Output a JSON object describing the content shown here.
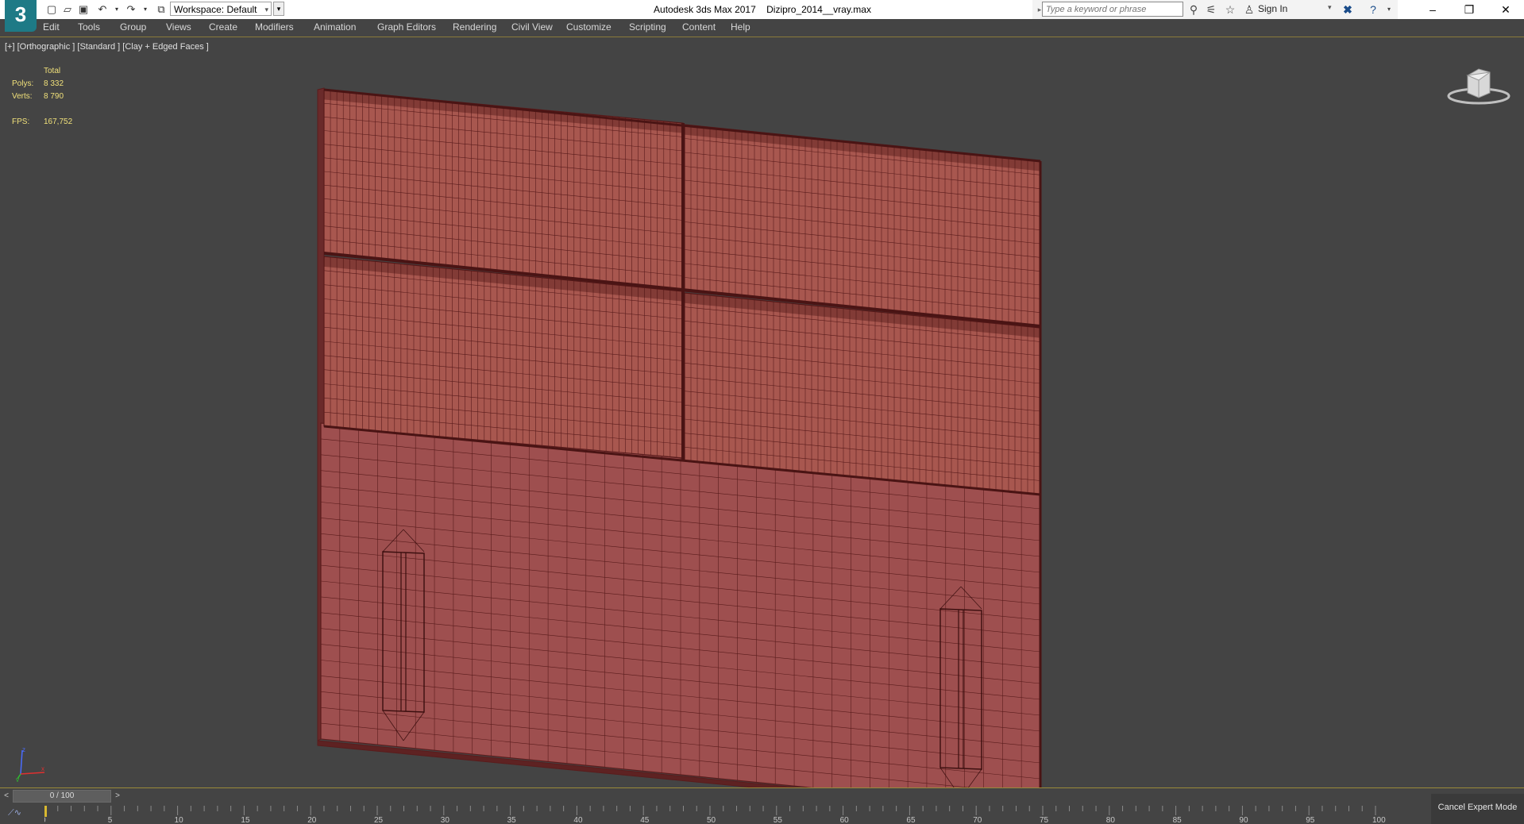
{
  "app": {
    "logo_text": "3",
    "window_title": "Autodesk 3ds Max 2017    Dizipro_2014__vray.max"
  },
  "quick_access": {
    "workspace_value": "Workspace: Default",
    "icons": [
      "new-file-icon",
      "open-file-icon",
      "save-icon",
      "undo-icon",
      "redo-icon",
      "project-folder-icon"
    ]
  },
  "search": {
    "placeholder": "Type a keyword or phrase"
  },
  "account": {
    "sign_in_label": "Sign In"
  },
  "window_controls": {
    "minimize": "–",
    "restore": "❐",
    "close": "✕"
  },
  "menu": {
    "items": [
      "Edit",
      "Tools",
      "Group",
      "Views",
      "Create",
      "Modifiers",
      "Animation",
      "Graph Editors",
      "Rendering",
      "Civil View",
      "Customize",
      "Scripting",
      "Content",
      "Help"
    ]
  },
  "viewport": {
    "label": "[+] [Orthographic ] [Standard ] [Clay + Edged Faces ]",
    "stats": {
      "header": "Total",
      "polys_label": "Polys:",
      "polys_value": "8 332",
      "verts_label": "Verts:",
      "verts_value": "8 790",
      "fps_label": "FPS:",
      "fps_value": "167,752"
    },
    "model_color": "#9e4f4f",
    "wire_color": "#5a1c1c"
  },
  "timeline": {
    "frame_display": "0 / 100",
    "prev_label": "<",
    "next_label": ">",
    "ticks": [
      "0",
      "5",
      "10",
      "15",
      "20",
      "25",
      "30",
      "35",
      "40",
      "45",
      "50",
      "55",
      "60",
      "65",
      "70",
      "75",
      "80",
      "85",
      "90",
      "95",
      "100"
    ]
  },
  "status": {
    "cancel_expert_label": "Cancel Expert Mode"
  }
}
